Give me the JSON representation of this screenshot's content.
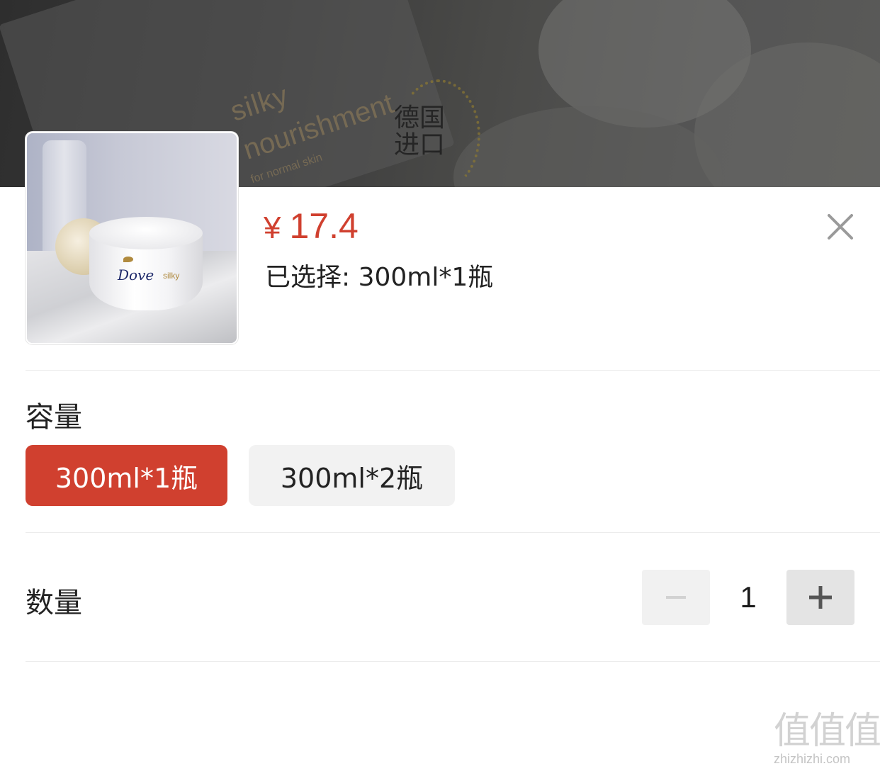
{
  "background": {
    "product_text_line1": "silky",
    "product_text_line2": "nourishment",
    "product_text_line3": "for normal skin",
    "badge": "德国进口"
  },
  "product": {
    "image_icon": "product-thumbnail",
    "brand": "Dove",
    "variant": "silky",
    "currency": "¥",
    "price": "17.4",
    "selected_text": "已选择: 300ml*1瓶"
  },
  "capacity": {
    "label": "容量",
    "options": [
      {
        "label": "300ml*1瓶",
        "selected": true
      },
      {
        "label": "300ml*2瓶",
        "selected": false
      }
    ]
  },
  "quantity": {
    "label": "数量",
    "value": "1",
    "minus_icon": "minus-icon",
    "plus_icon": "plus-icon"
  },
  "close_icon": "close-icon",
  "watermark": {
    "glyphs": "值值值",
    "url": "zhizhizhi.com"
  },
  "colors": {
    "accent": "#d0402f",
    "option_inactive_bg": "#f2f2f2",
    "divider": "#ececec"
  }
}
